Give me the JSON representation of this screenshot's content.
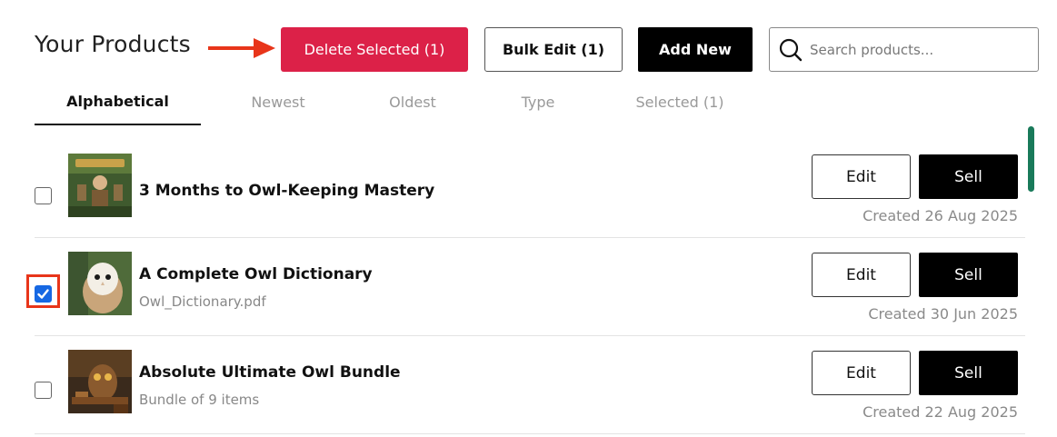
{
  "header": {
    "title": "Your Products",
    "delete_label": "Delete Selected (1)",
    "bulk_edit_label": "Bulk Edit (1)",
    "add_new_label": "Add New"
  },
  "search": {
    "placeholder": "Search products...",
    "value": ""
  },
  "tabs": [
    {
      "label": "Alphabetical",
      "active": true
    },
    {
      "label": "Newest",
      "active": false
    },
    {
      "label": "Oldest",
      "active": false
    },
    {
      "label": "Type",
      "active": false
    },
    {
      "label": "Selected (1)",
      "active": false
    }
  ],
  "products": [
    {
      "name": "3 Months to Owl-Keeping Mastery",
      "subtitle": "",
      "created": "Created 26 Aug 2025",
      "checked": false,
      "edit_label": "Edit",
      "sell_label": "Sell"
    },
    {
      "name": "A Complete Owl Dictionary",
      "subtitle": "Owl_Dictionary.pdf",
      "created": "Created 30 Jun 2025",
      "checked": true,
      "edit_label": "Edit",
      "sell_label": "Sell"
    },
    {
      "name": "Absolute Ultimate Owl Bundle",
      "subtitle": "Bundle of 9 items",
      "created": "Created 22 Aug 2025",
      "checked": false,
      "edit_label": "Edit",
      "sell_label": "Sell"
    }
  ],
  "colors": {
    "delete": "#dc2148",
    "checkbox": "#1668e3",
    "highlight": "#e8351a",
    "scrollbar": "#197a5a"
  }
}
